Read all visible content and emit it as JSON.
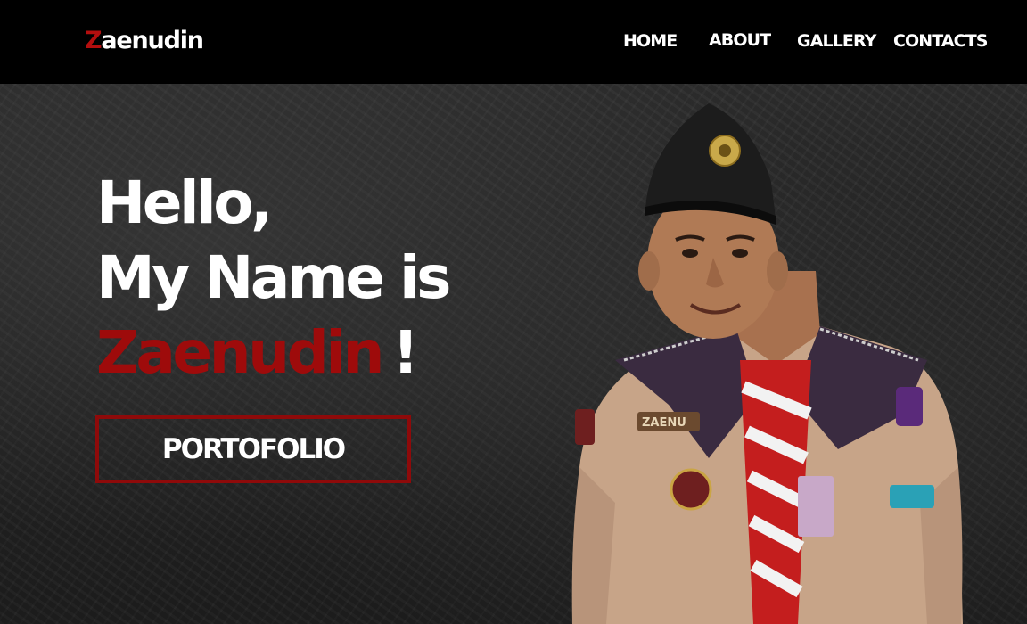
{
  "header": {
    "logo_first_letter": "Z",
    "logo_rest": "aenudin",
    "nav": {
      "home": "HOME",
      "about": "ABOUT",
      "gallery": "GALLERY",
      "contacts": "CONTACTS"
    }
  },
  "hero": {
    "line1": "Hello,",
    "line2": "My Name is",
    "name": "Zaenudin",
    "exclamation": "!",
    "button_label": "PORTOFOLIO",
    "portrait_name_tag": "ZAENU"
  },
  "colors": {
    "accent_red": "#9e0b0b",
    "navbar_bg": "#000000",
    "hero_bg": "#262626"
  },
  "icons": [
    "portrait-photo"
  ]
}
